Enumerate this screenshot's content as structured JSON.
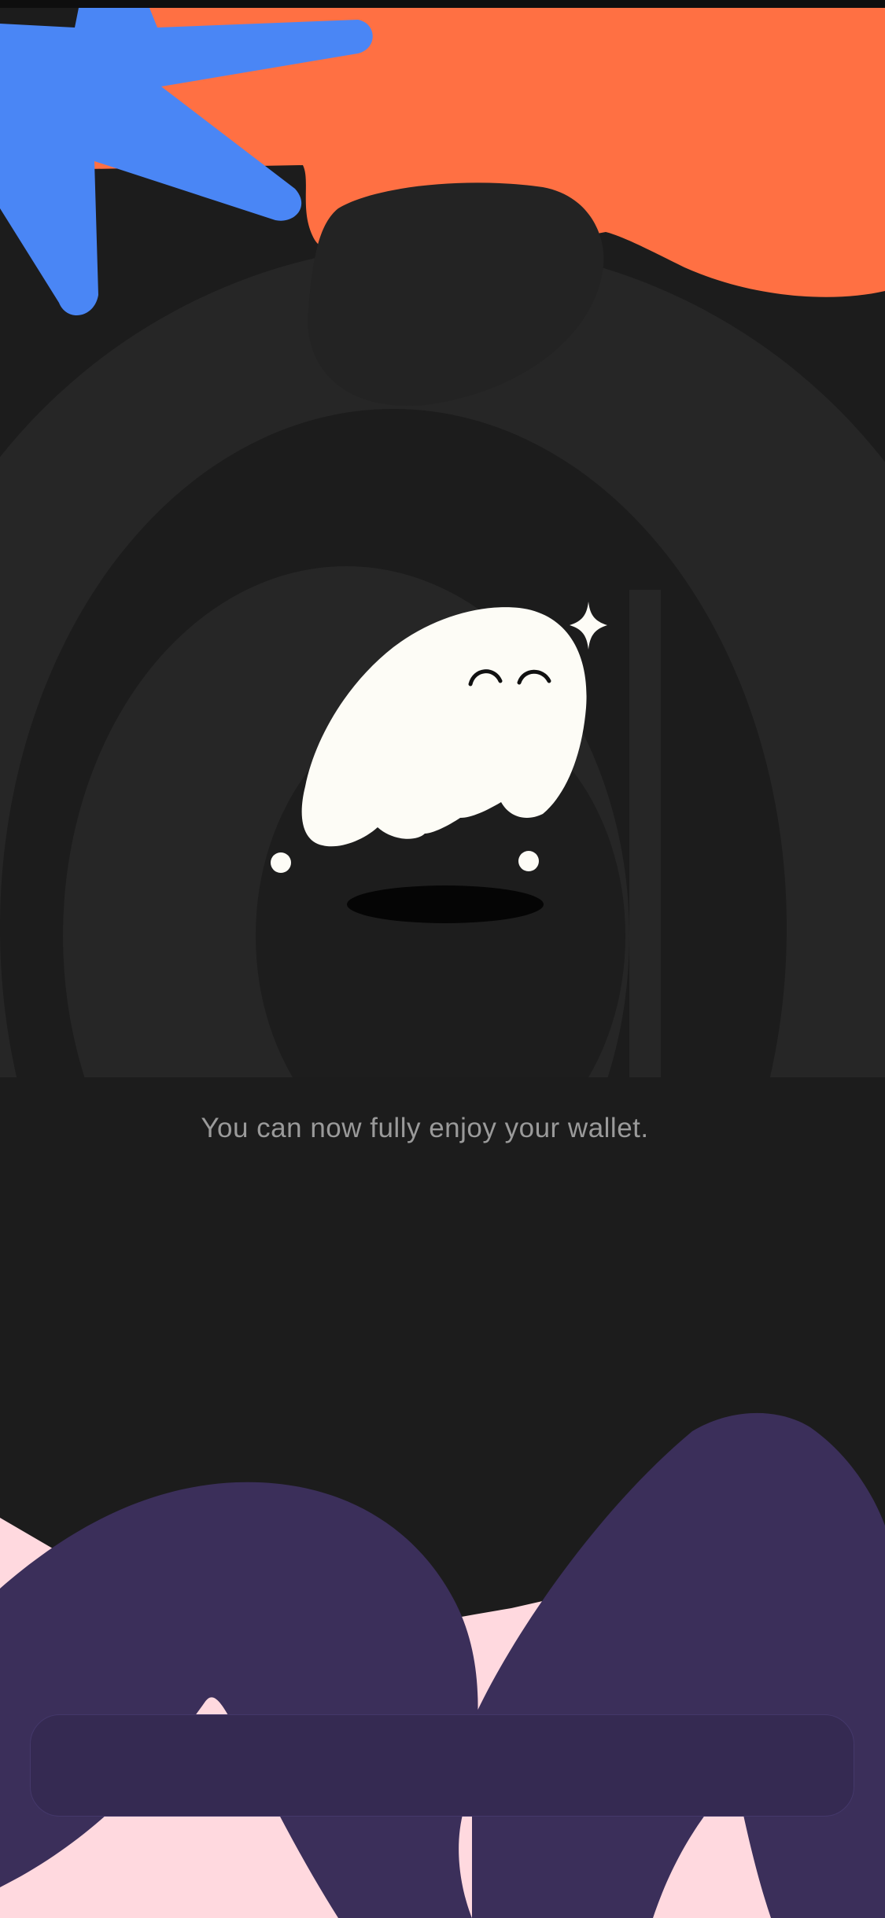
{
  "onboarding": {
    "message": "You can now fully enjoy your wallet.",
    "primary_button_label": ""
  },
  "colors": {
    "background": "#1c1c1c",
    "orange_shape": "#ff7043",
    "blue_star": "#4a86f5",
    "purple_shape": "#3b2f5a",
    "pink_shape": "#ffd9df",
    "ghost_white": "#fdfcf6",
    "button": "#352a52",
    "message_text": "#9a9a9a"
  },
  "icons": {
    "mascot": "ghost-mascot-icon",
    "sparkle": "sparkle-icon"
  }
}
